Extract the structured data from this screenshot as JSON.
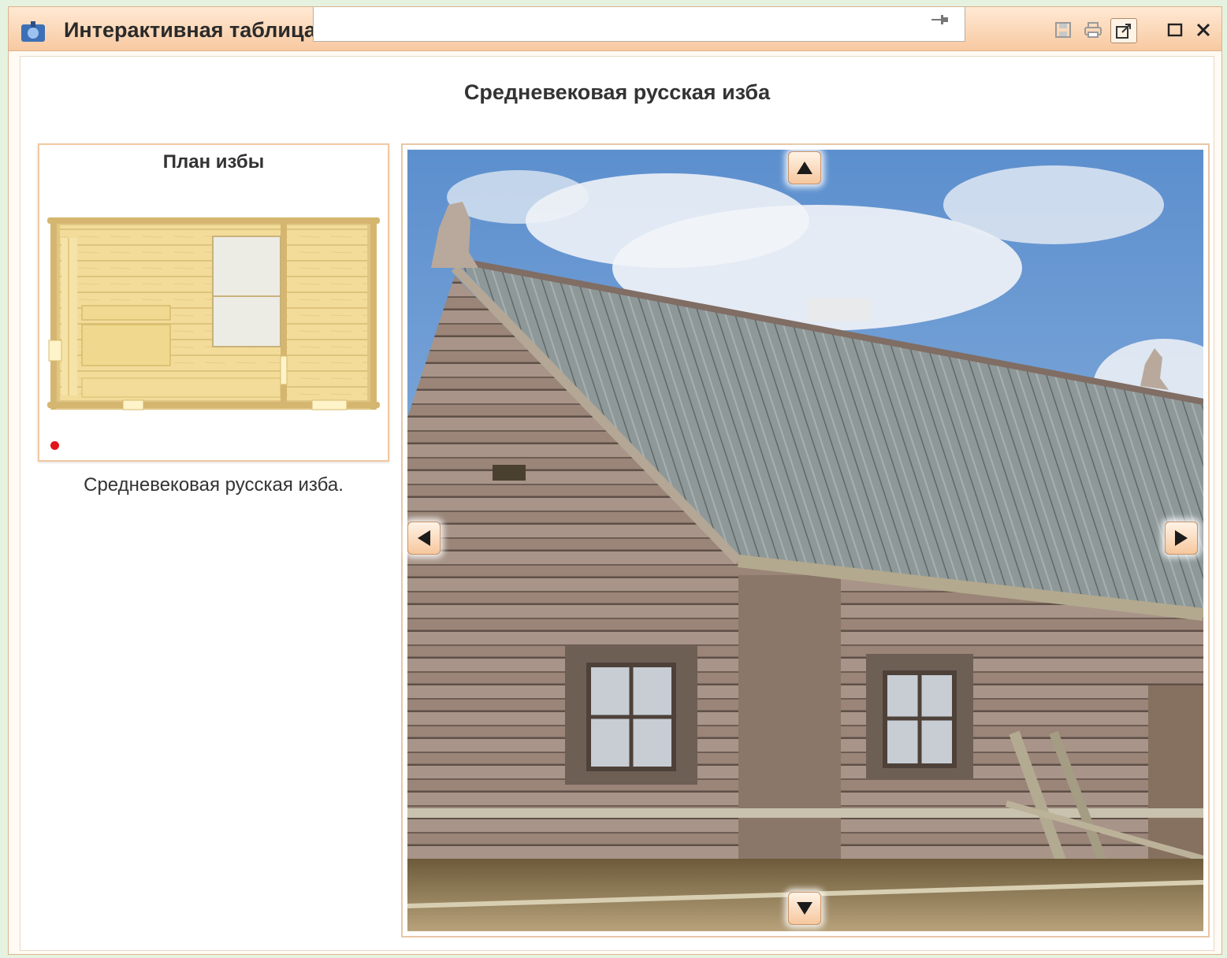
{
  "window": {
    "title": "Интерактивная таблица",
    "title_field_value": ""
  },
  "toolbar": {
    "icons": [
      "save-icon",
      "print-icon",
      "export-icon",
      "maximize-icon",
      "close-icon"
    ]
  },
  "page": {
    "title": "Средневековая русская изба"
  },
  "plan_panel": {
    "title": "План избы",
    "marker_color": "#e3141b"
  },
  "caption": "Средневековая русская изба.",
  "viewer": {
    "nav_buttons": [
      "arrow-up-icon",
      "arrow-down-icon",
      "arrow-left-icon",
      "arrow-right-icon"
    ]
  },
  "colors": {
    "titlebar": "#f8c9a1",
    "accent_border": "#f2c9a2",
    "background": "#e6f2e0"
  }
}
